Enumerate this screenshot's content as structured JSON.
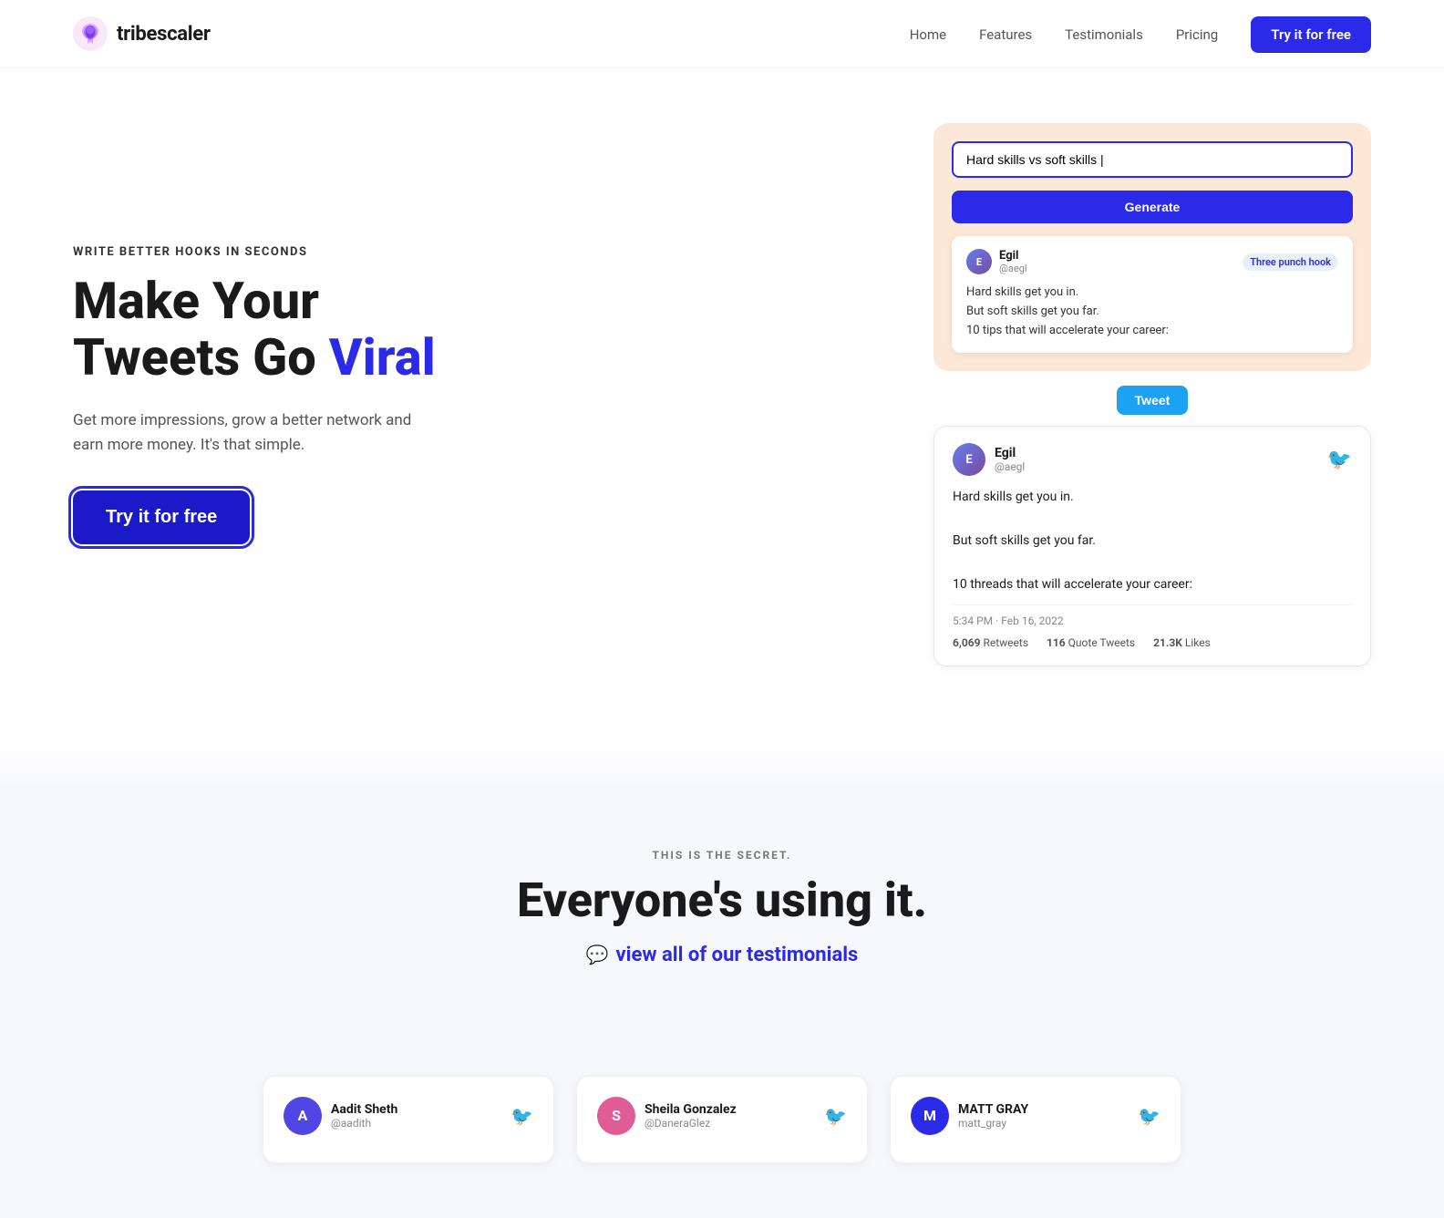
{
  "navbar": {
    "logo_text": "tribescaler",
    "nav_items": [
      {
        "label": "Home",
        "href": "#"
      },
      {
        "label": "Features",
        "href": "#"
      },
      {
        "label": "Testimonials",
        "href": "#"
      },
      {
        "label": "Pricing",
        "href": "#"
      }
    ],
    "cta_label": "Try it for free"
  },
  "hero": {
    "eyebrow": "WRITE BETTER HOOKS IN SECONDS",
    "title_part1": "Make Your\nTweets Go ",
    "title_highlight": "Viral",
    "subtitle": "Get more impressions, grow a better network and earn more money. It's that simple.",
    "cta_label": "Try it for free",
    "demo": {
      "input_value": "Hard skills vs soft skills",
      "input_placeholder": "Hard skills vs soft skills |",
      "generate_label": "Generate",
      "card": {
        "username": "Egil",
        "handle": "@aegl",
        "tag": "Three punch hook",
        "lines": [
          "Hard skills get you in.",
          "But soft skills get you far.",
          "10 tips that will accelerate your career:"
        ]
      },
      "tweet_btn": "Tweet"
    },
    "tweet_preview": {
      "username": "Egil",
      "handle": "@aegl",
      "lines": [
        "Hard skills get you in.",
        "",
        "But soft skills get you far.",
        "",
        "10 threads that will accelerate your career:"
      ],
      "timestamp": "5:34 PM · Feb 16, 2022",
      "retweets": "6,069",
      "retweets_label": "Retweets",
      "quote_tweets": "116",
      "quote_tweets_label": "Quote Tweets",
      "likes": "21.3K",
      "likes_label": "Likes"
    }
  },
  "secret_section": {
    "eyebrow": "THIS IS THE SECRET.",
    "title": "Everyone's using it.",
    "link_label": "view all of our testimonials",
    "link_icon": "💬"
  },
  "testimonials": [
    {
      "name": "Aadit Sheth",
      "handle": "@aadith",
      "avatar_letter": "A",
      "avatar_bg": "#4f46e5"
    },
    {
      "name": "Sheila Gonzalez",
      "handle": "@DanerаGlez",
      "avatar_letter": "S",
      "avatar_bg": "#e05c97"
    },
    {
      "name": "MATT GRAY",
      "handle": "matt_gray",
      "avatar_letter": "M",
      "avatar_bg": "#2a2ae8"
    }
  ]
}
